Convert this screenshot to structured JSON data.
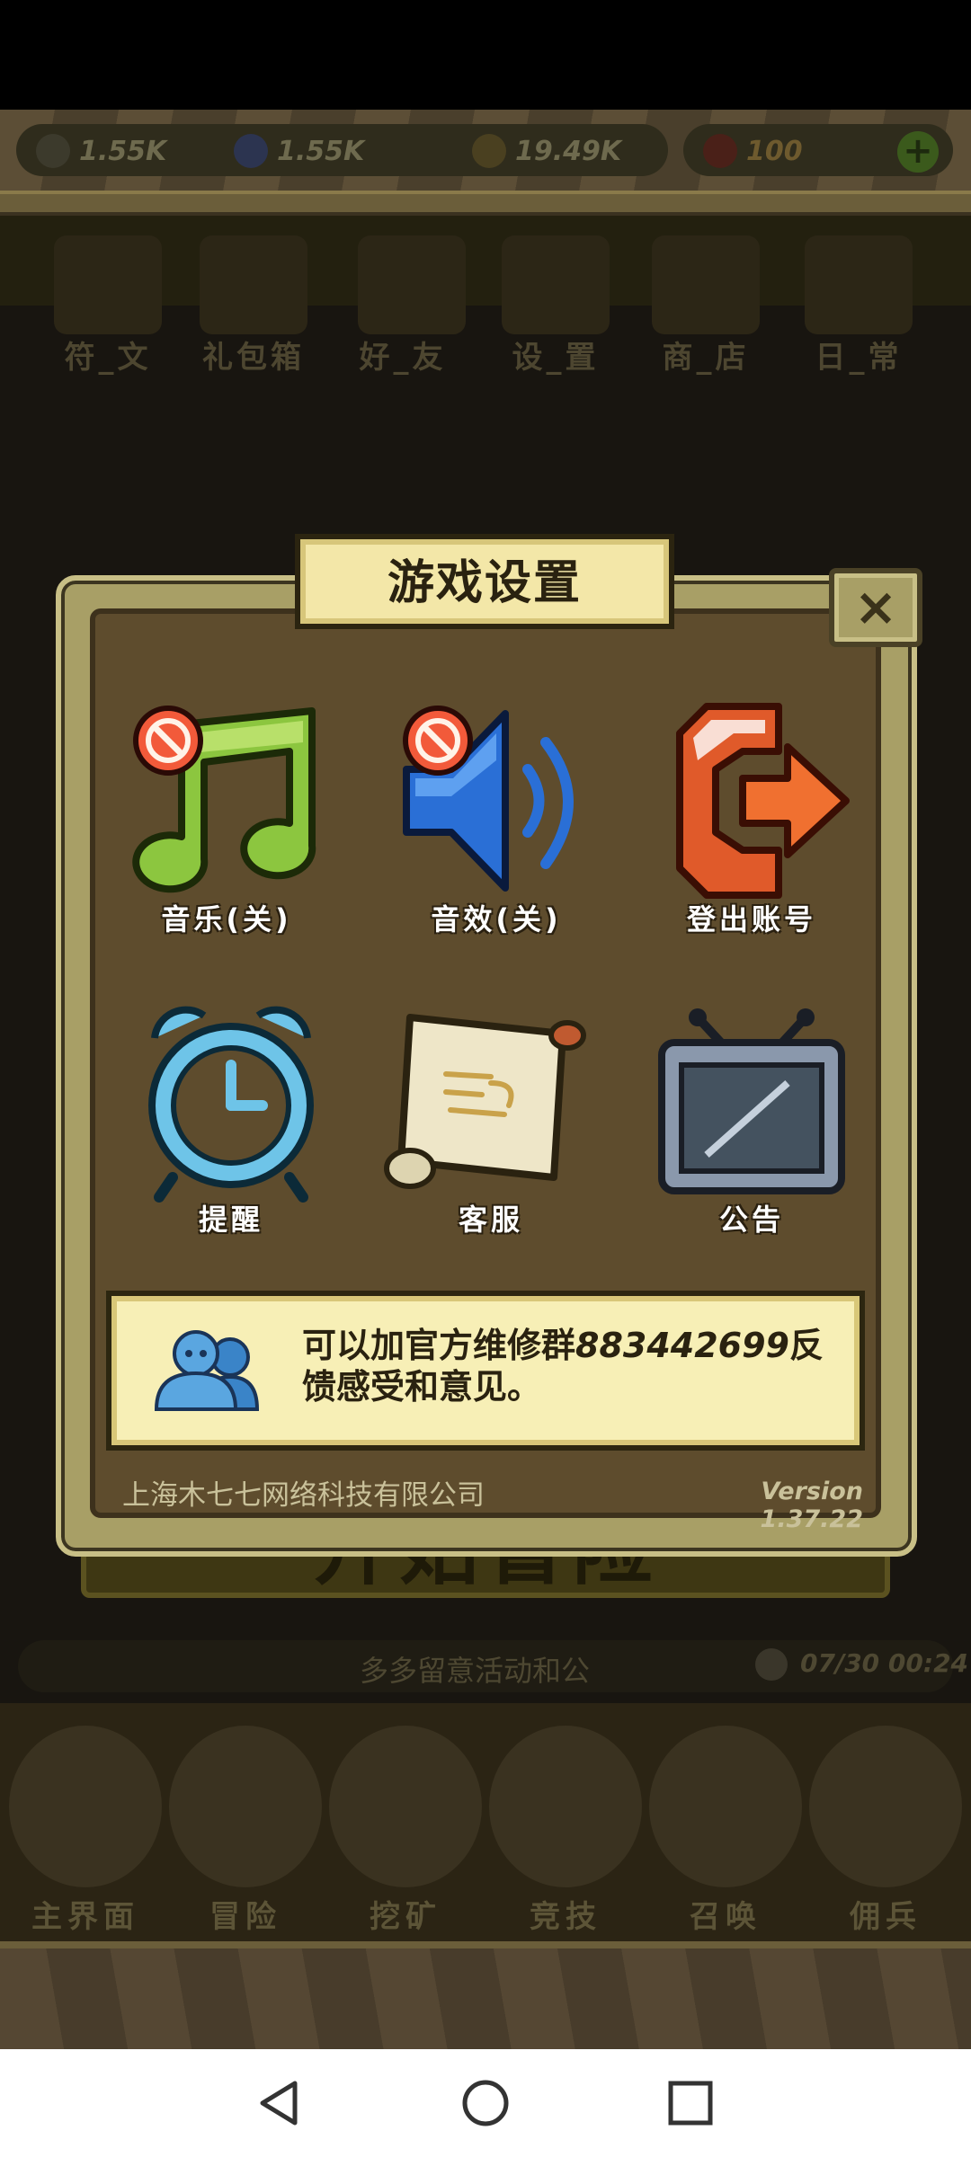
{
  "status_bar": {},
  "resources": [
    {
      "icon": "sword-icon",
      "value": "1.55K",
      "color": "#6b6a55"
    },
    {
      "icon": "exp-icon",
      "value": "1.55K",
      "color": "#3d5aa0"
    },
    {
      "icon": "coin-icon",
      "value": "19.49K",
      "color": "#7a6a2a"
    },
    {
      "icon": "gem-icon",
      "value": "100",
      "color": "#7a2a20"
    }
  ],
  "top_menu": [
    "符_文",
    "礼包箱",
    "好_友",
    "设_置",
    "商_店",
    "日_常"
  ],
  "modal": {
    "title": "游戏设置",
    "close_label": "×",
    "settings": [
      {
        "label": "音乐(关)",
        "icon": "music-note-icon",
        "disabled": true
      },
      {
        "label": "音效(关)",
        "icon": "speaker-icon",
        "disabled": true
      },
      {
        "label": "登出账号",
        "icon": "logout-icon",
        "disabled": false
      },
      {
        "label": "提醒",
        "icon": "alarm-clock-icon",
        "disabled": false
      },
      {
        "label": "客服",
        "icon": "scroll-icon",
        "disabled": false
      },
      {
        "label": "公告",
        "icon": "announcement-board-icon",
        "disabled": false
      }
    ],
    "info_prefix": "可以加官方维修群",
    "info_number": "883442699",
    "info_suffix": "反馈感受和意见。",
    "company": "上海木七七网络科技有限公司",
    "version": "Version 1.37.22"
  },
  "start_button": "开始冒险",
  "ticker": {
    "text": "多多留意活动和公",
    "time": "07/30 00:24"
  },
  "bottom_nav": [
    "主界面",
    "冒险",
    "挖矿",
    "竞技",
    "召唤",
    "佣兵"
  ],
  "colors": {
    "modal_bg": "#5e4c2d",
    "plate": "#f3e7a8",
    "logout_orange": "#e8602a",
    "music_green": "#8cc63f",
    "speaker_blue": "#2a6fd6",
    "disabled_red": "#e03020"
  }
}
